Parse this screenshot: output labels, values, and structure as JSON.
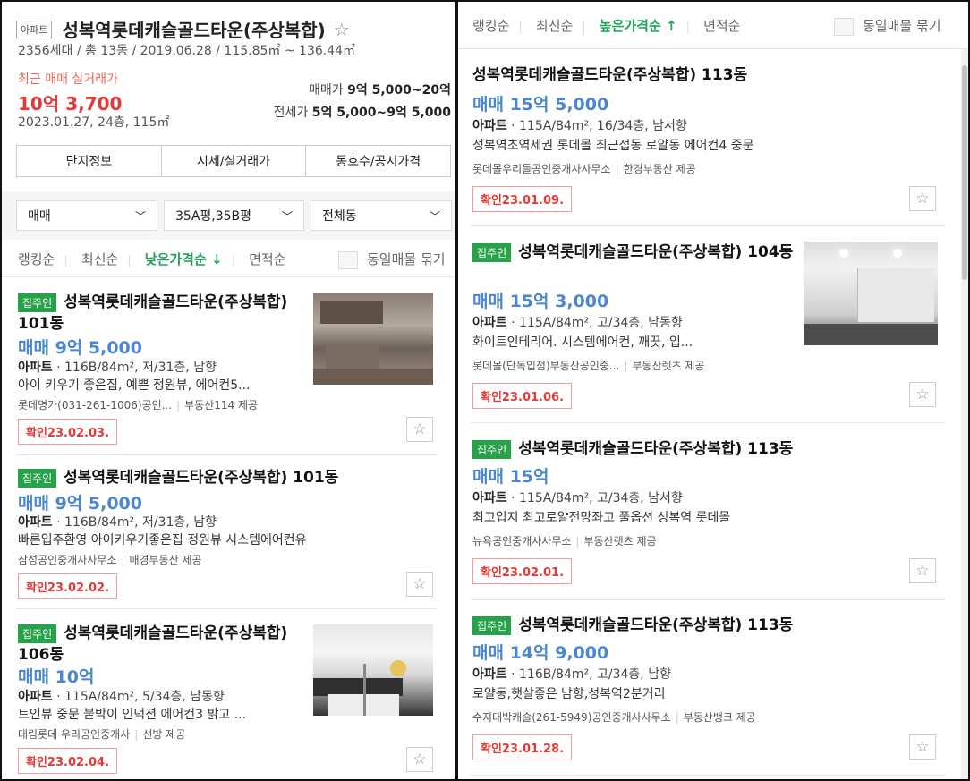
{
  "header": {
    "type_tag": "아파트",
    "title": "성복역롯데캐슬골드타운(주상복합)",
    "meta": "2356세대 / 총 13동 / 2019.06.28 / 115.85㎡ ~ 136.44㎡",
    "recent_label": "최근 매매 실거래가",
    "recent_price": "10억 3,700",
    "recent_detail": "2023.01.27, 24층, 115㎡",
    "sale_label": "매매가",
    "sale_range": "9억 5,000~20억",
    "jeonse_label": "전세가",
    "jeonse_range": "5억 5,000~9억 5,000"
  },
  "tabs": [
    "단지정보",
    "시세/실거래가",
    "동호수/공시가격"
  ],
  "filters": [
    "매매",
    "35A평,35B평",
    "전체동"
  ],
  "left_sort": {
    "items": [
      "랭킹순",
      "최신순",
      "낮은가격순 ↓",
      "면적순"
    ],
    "group_label": "동일매물 묶기"
  },
  "right_sort": {
    "items": [
      "랭킹순",
      "최신순",
      "높은가격순 ↑",
      "면적순"
    ],
    "group_label": "동일매물 묶기"
  },
  "left_listings": [
    {
      "tag": "집주인",
      "title": "성복역롯데캐슬골드타운(주상복합) 101동",
      "price": "매매 9억 5,000",
      "type": "아파트",
      "spec": "116B/84m², 저/31층, 남향",
      "desc": "아이 키우기 좋은집, 예쁜 정원뷰, 에어컨5...",
      "agent": "롯데명가(031-261-1006)공인...",
      "provider": "부동산114 제공",
      "confirm": "확인23.02.03."
    },
    {
      "tag": "집주인",
      "title": "성복역롯데캐슬골드타운(주상복합) 101동",
      "price": "매매 9억 5,000",
      "type": "아파트",
      "spec": "116B/84m², 저/31층, 남향",
      "desc": "빠른입주환영 아이키우기좋은집 정원뷰 시스템에어컨유",
      "agent": "삼성공인중개사사무소",
      "provider": "매경부동산 제공",
      "confirm": "확인23.02.02."
    },
    {
      "tag": "집주인",
      "title": "성복역롯데캐슬골드타운(주상복합) 106동",
      "price": "매매 10억",
      "type": "아파트",
      "spec": "115A/84m², 5/34층, 남동향",
      "desc": "트인뷰 중문 붙박이 인덕션 에어컨3 밝고 ...",
      "agent": "대림롯데 우리공인중개사",
      "provider": "선방 제공",
      "confirm": "확인23.02.04."
    }
  ],
  "right_listings": [
    {
      "tag": "",
      "title": "성복역롯데캐슬골드타운(주상복합) 113동",
      "price": "매매 15억 5,000",
      "type": "아파트",
      "spec": "115A/84m², 16/34층, 남서향",
      "desc": "성복역초역세권 롯데몰 최근접동 로얄동 에어컨4 중문",
      "agent": "롯데몰우리들공인중개사사무소",
      "provider": "한경부동산 제공",
      "confirm": "확인23.01.09."
    },
    {
      "tag": "집주인",
      "title": "성복역롯데캐슬골드타운(주상복합) 104동",
      "price": "매매 15억 3,000",
      "type": "아파트",
      "spec": "115A/84m², 고/34층, 남동향",
      "desc": "화이트인테리어. 시스템에어컨, 깨끗, 입...",
      "agent": "롯데몰(단독입점)부동산공인중...",
      "provider": "부동산렛츠 제공",
      "confirm": "확인23.01.06."
    },
    {
      "tag": "집주인",
      "title": "성복역롯데캐슬골드타운(주상복합) 113동",
      "price": "매매 15억",
      "type": "아파트",
      "spec": "115A/84m², 고/34층, 남서향",
      "desc": "최고입지 최고로얄전망좌고 풀옵션 성복역 롯데몰",
      "agent": "뉴욕공인중개사사무소",
      "provider": "부동산렛츠 제공",
      "confirm": "확인23.02.01."
    },
    {
      "tag": "집주인",
      "title": "성복역롯데캐슬골드타운(주상복합) 113동",
      "price": "매매 14억 9,000",
      "type": "아파트",
      "spec": "116B/84m², 고/34층, 남향",
      "desc": "로얄동,햇살좋은 남향,성복역2분거리",
      "agent": "수지대박캐슬(261-5949)공인중개사사무소",
      "provider": "부동산뱅크 제공",
      "confirm": "확인23.01.28."
    }
  ],
  "colors": {
    "accent_green": "#27a24a",
    "price_blue": "#4a86d6",
    "recent_red": "#e53935"
  }
}
